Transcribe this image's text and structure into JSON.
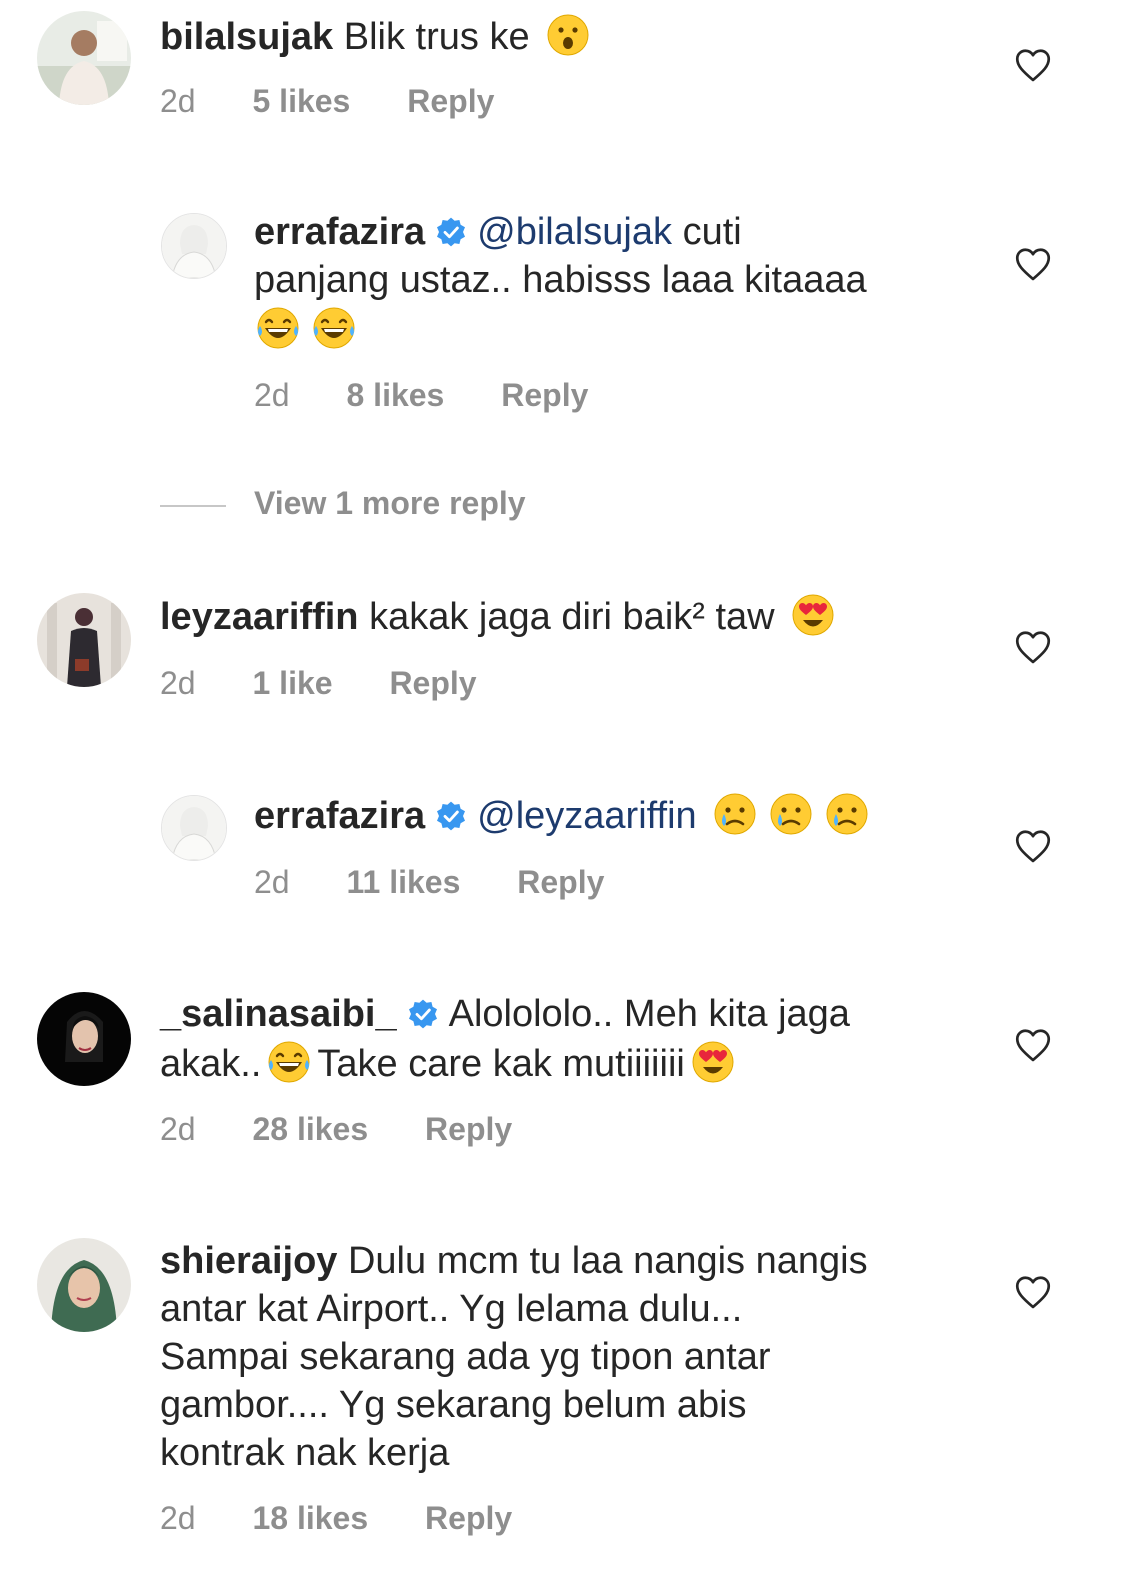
{
  "comments": [
    {
      "username": "bilalsujak",
      "text_parts": [
        "Blik trus ke"
      ],
      "time": "2d",
      "likes": "5 likes",
      "reply": "Reply"
    },
    {
      "username": "errafazira",
      "mention": "@bilalsujak",
      "text_line1": "cuti",
      "text_line2": "panjang ustaz.. habisss laaa kitaaaa",
      "time": "2d",
      "likes": "8 likes",
      "reply": "Reply"
    },
    {
      "view_more": "View 1 more reply"
    },
    {
      "username": "leyzaariffin",
      "text": "kakak jaga diri baik² taw",
      "time": "2d",
      "likes": "1 like",
      "reply": "Reply"
    },
    {
      "username": "errafazira",
      "mention": "@leyzaariffin",
      "time": "2d",
      "likes": "11 likes",
      "reply": "Reply"
    },
    {
      "username": "_salinasaibi_",
      "text_line1": "Alolololo.. Meh kita jaga",
      "text_line2a": "akak..",
      "text_line2b": "Take care kak mutiiiiiii",
      "time": "2d",
      "likes": "28 likes",
      "reply": "Reply"
    },
    {
      "username": "shieraijoy",
      "text_line1": "Dulu mcm tu laa nangis nangis",
      "text_line2": "antar kat Airport.. Yg lelama dulu...",
      "text_line3": "Sampai sekarang ada yg tipon antar",
      "text_line4": "gambor.... Yg sekarang belum abis",
      "text_line5": "kontrak nak kerja",
      "time": "2d",
      "likes": "18 likes",
      "reply": "Reply"
    }
  ],
  "icons": {
    "like": "heart-outline-icon",
    "verified": "verified-badge-icon",
    "accent": "#3897f0",
    "muted": "#8e8e8e",
    "mention_color": "#1d3b6e"
  }
}
